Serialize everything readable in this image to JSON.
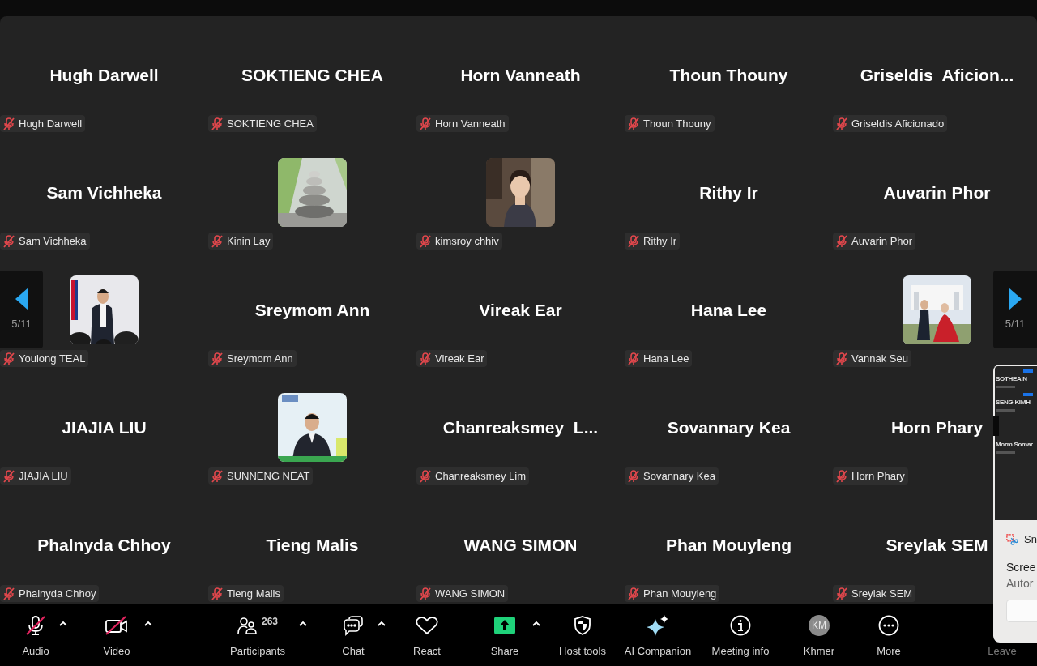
{
  "gallery": {
    "tiles": [
      {
        "kind": "name",
        "name": "Hugh Darwell",
        "label": "Hugh Darwell",
        "muted": true
      },
      {
        "kind": "name",
        "name": "SOKTIENG CHEA",
        "label": "SOKTIENG CHEA",
        "muted": true
      },
      {
        "kind": "name",
        "name": "Horn Vanneath",
        "label": "Horn Vanneath",
        "muted": true
      },
      {
        "kind": "name",
        "name": "Thoun Thouny",
        "label": "Thoun Thouny",
        "muted": true
      },
      {
        "kind": "name",
        "name": "Griseldis  Aficion...",
        "label": "Griseldis Aficionado",
        "muted": true
      },
      {
        "kind": "name",
        "name": "Sam Vichheka",
        "label": "Sam Vichheka",
        "muted": true
      },
      {
        "kind": "picture",
        "label": "Kinin Lay",
        "muted": true
      },
      {
        "kind": "picture",
        "label": "kimsroy chhiv",
        "muted": true
      },
      {
        "kind": "name",
        "name": "Rithy Ir",
        "label": "Rithy Ir",
        "muted": true
      },
      {
        "kind": "name",
        "name": "Auvarin Phor",
        "label": "Auvarin Phor",
        "muted": true
      },
      {
        "kind": "picture",
        "label": "Youlong TEAL",
        "muted": true
      },
      {
        "kind": "name",
        "name": "Sreymom Ann",
        "label": "Sreymom Ann",
        "muted": true
      },
      {
        "kind": "name",
        "name": "Vireak Ear",
        "label": "Vireak Ear",
        "muted": true
      },
      {
        "kind": "name",
        "name": "Hana Lee",
        "label": "Hana Lee",
        "muted": true
      },
      {
        "kind": "picture",
        "label": "Vannak Seu",
        "muted": true
      },
      {
        "kind": "name",
        "name": "JIAJIA LIU",
        "label": "JIAJIA LIU",
        "muted": true
      },
      {
        "kind": "picture",
        "label": "SUNNENG NEAT",
        "muted": true
      },
      {
        "kind": "name",
        "name": "Chanreaksmey  L...",
        "label": "Chanreaksmey Lim",
        "muted": true
      },
      {
        "kind": "name",
        "name": "Sovannary Kea",
        "label": "Sovannary Kea",
        "muted": true
      },
      {
        "kind": "name",
        "name": "Horn Phary",
        "label": "Horn Phary",
        "muted": true
      },
      {
        "kind": "name",
        "name": "Phalnyda Chhoy",
        "label": "Phalnyda Chhoy",
        "muted": true
      },
      {
        "kind": "name",
        "name": "Tieng Malis",
        "label": "Tieng Malis",
        "muted": true
      },
      {
        "kind": "name",
        "name": "WANG SIMON",
        "label": "WANG SIMON",
        "muted": true
      },
      {
        "kind": "name",
        "name": "Phan Mouyleng",
        "label": "Phan Mouyleng",
        "muted": true
      },
      {
        "kind": "name",
        "name": "Sreylak SEM",
        "label": "Sreylak SEM",
        "muted": true
      }
    ],
    "page_left": "5/11",
    "page_right": "5/11"
  },
  "toolbar": [
    {
      "kind": "audio",
      "label": "Audio",
      "off": true,
      "caret": true
    },
    {
      "kind": "video",
      "label": "Video",
      "off": true,
      "caret": true
    },
    {
      "kind": "participants",
      "label": "Participants",
      "count": "263",
      "caret": true
    },
    {
      "kind": "chat",
      "label": "Chat",
      "caret": true
    },
    {
      "kind": "react",
      "label": "React",
      "caret": false
    },
    {
      "kind": "share",
      "label": "Share",
      "caret": true
    },
    {
      "kind": "host",
      "label": "Host tools",
      "caret": false
    },
    {
      "kind": "ai",
      "label": "AI Companion",
      "caret": false
    },
    {
      "kind": "info",
      "label": "Meeting info",
      "caret": false
    },
    {
      "kind": "avatar",
      "label": "Khmer",
      "initials": "KM",
      "caret": false
    },
    {
      "kind": "more",
      "label": "More",
      "caret": false
    },
    {
      "kind": "leave",
      "label": "Leave",
      "caret": false
    }
  ],
  "snip_overlay": {
    "thumbnail_names": [
      "SOTHEA N",
      "SENG KIMH",
      "Morm Somar"
    ],
    "app_name": "Sn",
    "lines": [
      "Scree",
      "Autor"
    ]
  }
}
